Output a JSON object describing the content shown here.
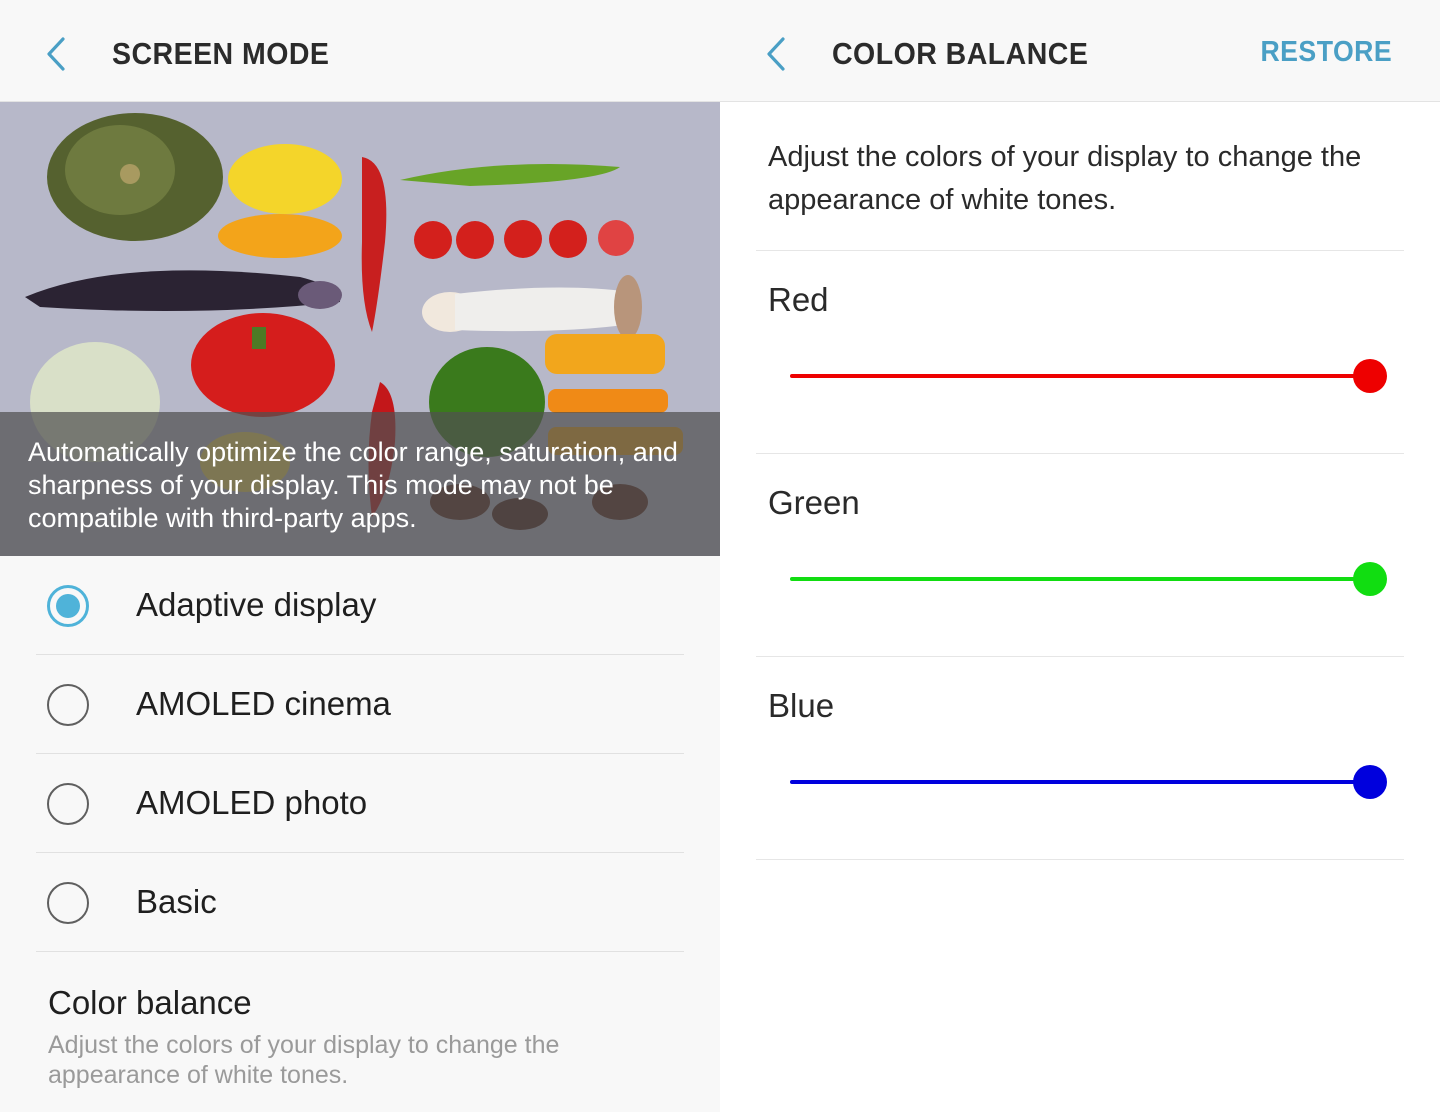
{
  "left_panel": {
    "title": "SCREEN MODE",
    "preview_caption": "Automatically optimize the color range, saturation, and sharpness of your display. This mode may not be compatible with third-party apps.",
    "modes": [
      {
        "label": "Adaptive display",
        "selected": true
      },
      {
        "label": "AMOLED cinema",
        "selected": false
      },
      {
        "label": "AMOLED photo",
        "selected": false
      },
      {
        "label": "Basic",
        "selected": false
      }
    ],
    "color_balance": {
      "title": "Color balance",
      "description": "Adjust the colors of your display to change the appearance of white tones."
    }
  },
  "right_panel": {
    "title": "COLOR BALANCE",
    "restore_label": "RESTORE",
    "intro": "Adjust the colors of your display to change the appearance of white tones.",
    "sliders": [
      {
        "label": "Red",
        "color": "#ee0000",
        "level": 1.0
      },
      {
        "label": "Green",
        "color": "#11dd11",
        "level": 1.0
      },
      {
        "label": "Blue",
        "color": "#0000dd",
        "level": 1.0
      }
    ]
  },
  "colors": {
    "accent": "#4fb3d9",
    "restore": "#4a9fc5"
  },
  "icons": {
    "back": "chevron-left-icon",
    "radio_selected": "radio-checked-icon",
    "radio_unselected": "radio-unchecked-icon"
  }
}
